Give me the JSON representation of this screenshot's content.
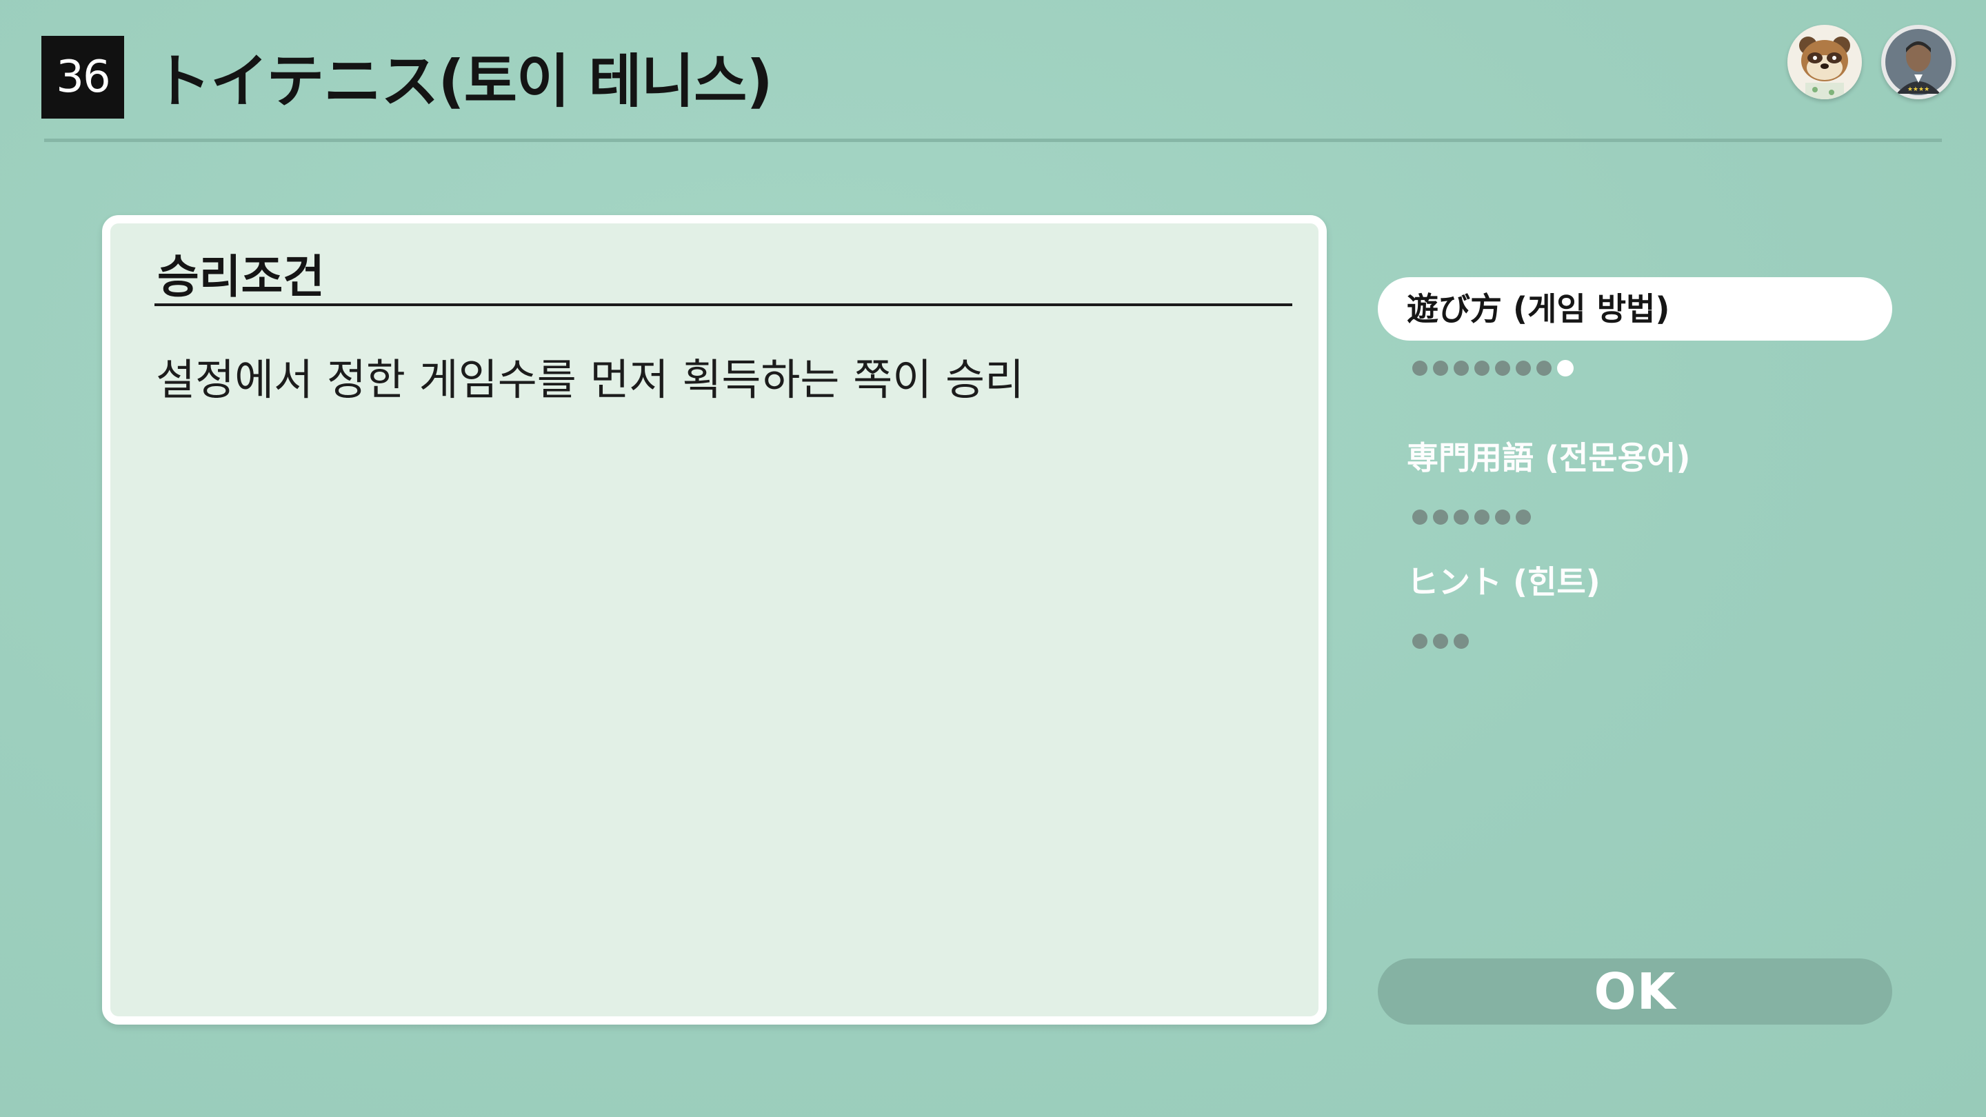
{
  "header": {
    "game_number": "36",
    "title": "トイテニス(토이 테니스)"
  },
  "avatars": [
    {
      "icon": "tanuki-character-icon"
    },
    {
      "icon": "player-avatar-icon"
    }
  ],
  "panel": {
    "heading": "승리조건",
    "body": "설정에서 정한 게임수를 먼저 획득하는 쪽이 승리"
  },
  "menu": {
    "items": [
      {
        "label": "遊び方 (게임 방법)",
        "active": true,
        "dots": 8,
        "current_dot": 8
      },
      {
        "label": "専門用語 (전문용어)",
        "active": false,
        "dots": 6,
        "current_dot": 0
      },
      {
        "label": "ヒント (힌트)",
        "active": false,
        "dots": 3,
        "current_dot": 0
      }
    ]
  },
  "ok_button": {
    "label": "OK"
  },
  "colors": {
    "background": "#9dcfbe",
    "panel": "#e2f0e6",
    "ok_button": "#85b2a3",
    "dot": "#7a8f88"
  }
}
